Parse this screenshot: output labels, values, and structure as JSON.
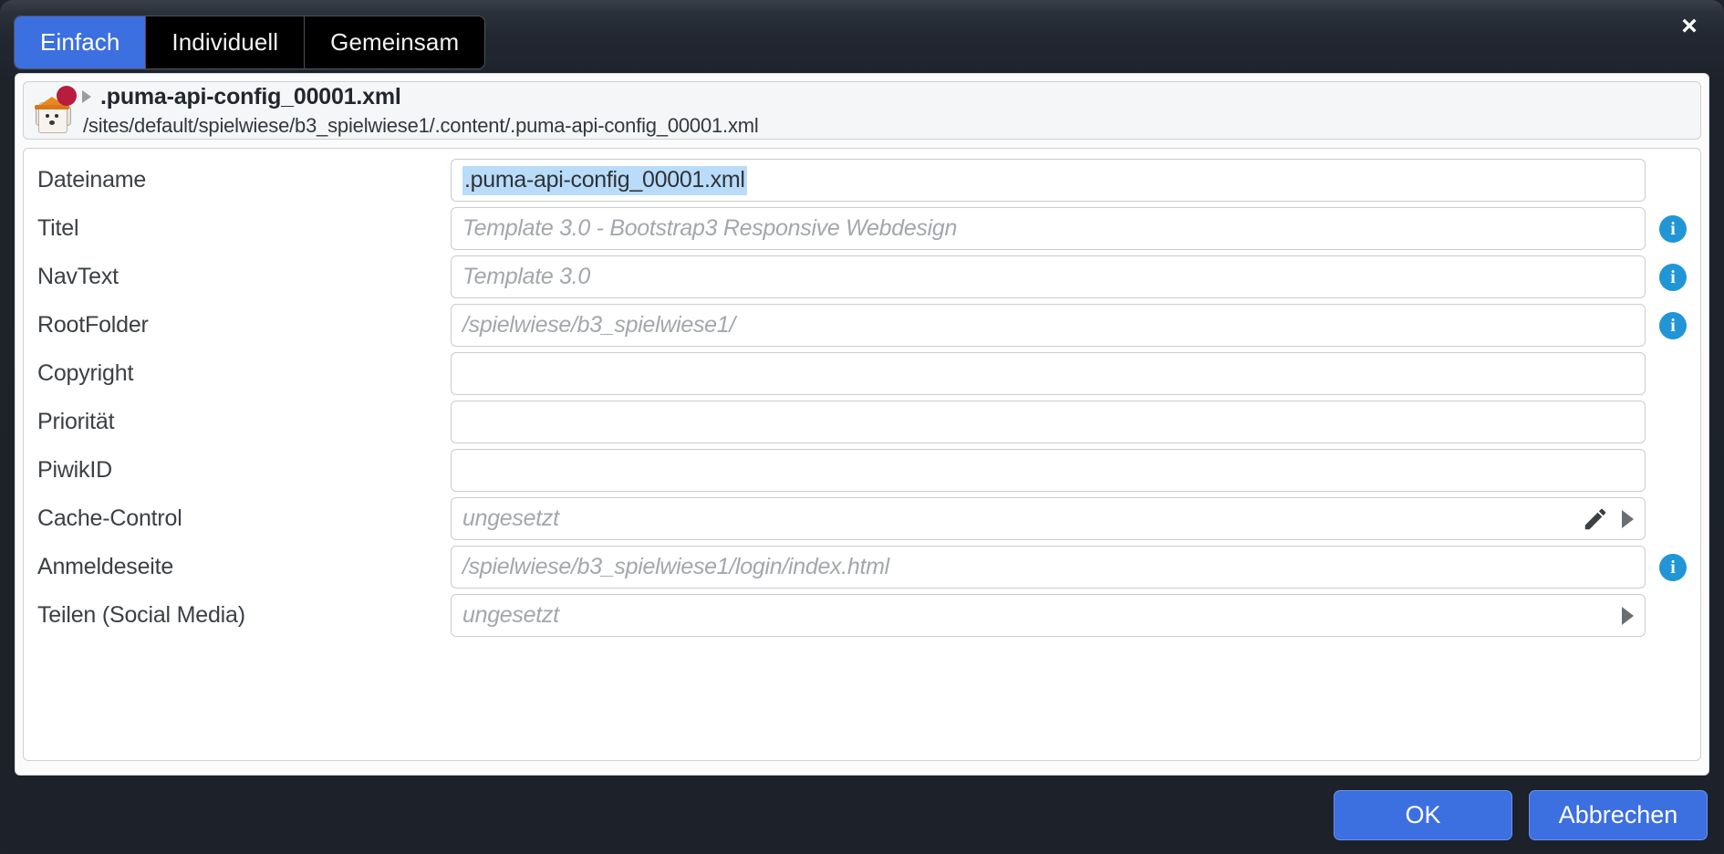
{
  "dialog": {
    "close_label": "×",
    "tabs": [
      {
        "label": "Einfach",
        "active": true
      },
      {
        "label": "Individuell",
        "active": false
      },
      {
        "label": "Gemeinsam",
        "active": false
      }
    ]
  },
  "resource": {
    "title": ".puma-api-config_00001.xml",
    "path": "/sites/default/spielwiese/b3_spielwiese1/.content/.puma-api-config_00001.xml",
    "icon": "site-config-icon",
    "badge_color": "#b81c3e",
    "expand_icon": "caret-right-icon"
  },
  "form": {
    "rows": [
      {
        "label": "Dateiname",
        "value": ".puma-api-config_00001.xml",
        "placeholder": "",
        "selected": true,
        "info": false,
        "edit_icon": false,
        "caret": false
      },
      {
        "label": "Titel",
        "value": "",
        "placeholder": "Template 3.0 - Bootstrap3 Responsive Webdesign",
        "selected": false,
        "info": true,
        "edit_icon": false,
        "caret": false
      },
      {
        "label": "NavText",
        "value": "",
        "placeholder": "Template 3.0",
        "selected": false,
        "info": true,
        "edit_icon": false,
        "caret": false
      },
      {
        "label": "RootFolder",
        "value": "",
        "placeholder": "/spielwiese/b3_spielwiese1/",
        "selected": false,
        "info": true,
        "edit_icon": false,
        "caret": false
      },
      {
        "label": "Copyright",
        "value": "",
        "placeholder": "",
        "selected": false,
        "info": false,
        "edit_icon": false,
        "caret": false
      },
      {
        "label": "Priorität",
        "value": "",
        "placeholder": "",
        "selected": false,
        "info": false,
        "edit_icon": false,
        "caret": false
      },
      {
        "label": "PiwikID",
        "value": "",
        "placeholder": "",
        "selected": false,
        "info": false,
        "edit_icon": false,
        "caret": false
      },
      {
        "label": "Cache-Control",
        "value": "",
        "placeholder": "ungesetzt",
        "selected": false,
        "info": false,
        "edit_icon": true,
        "caret": true
      },
      {
        "label": "Anmeldeseite",
        "value": "",
        "placeholder": "/spielwiese/b3_spielwiese1/login/index.html",
        "selected": false,
        "info": true,
        "edit_icon": false,
        "caret": false
      },
      {
        "label": "Teilen (Social Media)",
        "value": "",
        "placeholder": "ungesetzt",
        "selected": false,
        "info": false,
        "edit_icon": false,
        "caret": true
      }
    ]
  },
  "footer": {
    "ok_label": "OK",
    "cancel_label": "Abbrechen"
  },
  "colors": {
    "accent": "#3c6fe0",
    "info": "#2196d6",
    "selection": "#b9dcfb",
    "chrome": "#1d222b"
  }
}
